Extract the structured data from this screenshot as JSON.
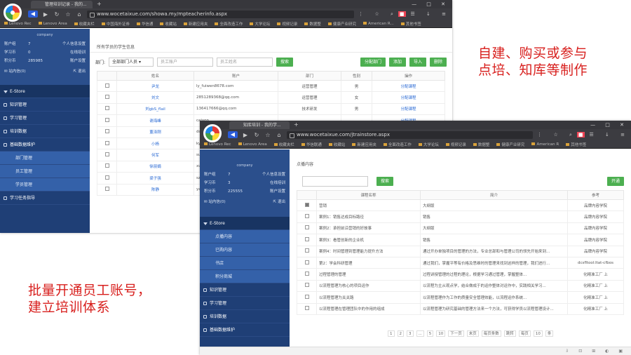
{
  "captions": {
    "top_right": [
      "自建、购买或参与",
      "点培、知库等制作"
    ],
    "bottom_left": [
      "批量开通员工账号，",
      "建立培训体系"
    ]
  },
  "window1": {
    "tab_title": "管理培训记录 - 我的...",
    "url": "www.wocetaixue.com/showa.my/mpteacherinfo.aspx",
    "bookmarks": [
      "Lenovo Rec",
      "Lenovo Area",
      "收藏夹栏",
      "中国海外证券",
      "华信通",
      "收藏站",
      "新建应用夹",
      "全面改造工作",
      "大学论坛",
      "视频记录",
      "数据整",
      "健康产业研究",
      "American R...",
      "其他书签"
    ],
    "sidebar": {
      "company": "company",
      "stats": [
        {
          "k": "账户组",
          "v": "7",
          "l": "个人信息设置"
        },
        {
          "k": "学习币",
          "v": "0",
          "l": "在线培训"
        },
        {
          "k": "积分币",
          "v": "285985",
          "l": "账户设置"
        }
      ],
      "mail": "站内信(0)",
      "exit": "退出",
      "menu": [
        {
          "label": "E-Store",
          "type": "hd"
        },
        {
          "label": "知识管理",
          "type": "m"
        },
        {
          "label": "学习管理",
          "type": "m"
        },
        {
          "label": "培训数据",
          "type": "m"
        },
        {
          "label": "基础数据维护",
          "type": "m"
        },
        {
          "label": "部门管理",
          "type": "sub"
        },
        {
          "label": "员工管理",
          "type": "sub"
        },
        {
          "label": "学员管理",
          "type": "sub"
        },
        {
          "label": "学习任务指导",
          "type": "m"
        }
      ]
    },
    "breadcrumb": "所有学员的学生信息",
    "filter_label": "部门:",
    "dept_select": "全部部门人员",
    "search_placeholder1": "员工账户",
    "search_placeholder2": "员工姓名",
    "search_btn": "搜索",
    "actions": [
      "分配部门",
      "添加",
      "导入",
      "删除"
    ],
    "columns": [
      "",
      "姓名",
      "账户",
      "部门",
      "性别",
      "操作"
    ],
    "rows": [
      [
        "",
        "尹龙",
        "ly_fuiwen8678.com",
        "运营管理",
        "男",
        "分配课程"
      ],
      [
        "",
        "刘文",
        "2851289368@qq.com",
        "运营管理",
        "女",
        "分配课程"
      ],
      [
        "",
        "刘gbS_flail",
        "136417666@qq.com",
        "技术研发",
        "男",
        "分配课程"
      ],
      [
        "",
        "谢海峰",
        "caiyon...",
        "",
        "",
        "分配课程"
      ],
      [
        "",
        "董泽刚",
        "dongzeg...",
        "",
        "",
        "分配课程"
      ],
      [
        "",
        "小杨",
        "ky_..",
        "",
        "",
        "分配课程"
      ],
      [
        "",
        "何军",
        "su26860...",
        "",
        "",
        "分配课程"
      ],
      [
        "",
        "徐丽娟",
        "xuli...",
        "",
        "",
        "分配课程"
      ],
      [
        "",
        "梁子强",
        "szo0ab...",
        "",
        "",
        "分配课程"
      ],
      [
        "",
        "陈静",
        "yangyan...",
        "",
        "",
        "分配课程"
      ]
    ]
  },
  "window2": {
    "tab_title": "知库培训 - 我的学...",
    "url": "www.wocetaixue.com/jtrainstore.aspx",
    "bookmarks": [
      "Lenovo Rec",
      "Lenovo Area",
      "收藏夹栏",
      "华信联通",
      "收藏站",
      "新建应用夹",
      "全面改造工作",
      "大学论坛",
      "视频记录",
      "数据整",
      "健康产业研究",
      "American R",
      "其他书签"
    ],
    "sidebar": {
      "company": "company",
      "stats": [
        {
          "k": "账户组",
          "v": "7",
          "l": "个人信息设置"
        },
        {
          "k": "学习币",
          "v": "3",
          "l": "在线培训"
        },
        {
          "k": "积分币",
          "v": "225555",
          "l": "账户设置"
        }
      ],
      "mail": "站内信(0)",
      "exit": "退出",
      "menu": [
        {
          "label": "E-Store",
          "type": "hd"
        },
        {
          "label": "点播内容",
          "type": "sub"
        },
        {
          "label": "已购内容",
          "type": "sub"
        },
        {
          "label": "书店",
          "type": "sub"
        },
        {
          "label": "积分商城",
          "type": "sub"
        },
        {
          "label": "知识管理",
          "type": "m"
        },
        {
          "label": "学习管理",
          "type": "m"
        },
        {
          "label": "培训数据",
          "type": "m"
        },
        {
          "label": "基础数据维护",
          "type": "m"
        }
      ]
    },
    "breadcrumb": "点播内容",
    "search_btn": "搜索",
    "open_btn": "开通",
    "columns": [
      "",
      "课程名称",
      "简介",
      "参考"
    ],
    "rows": [
      {
        "on": true,
        "name": "营销",
        "intro": "大纲版",
        "ref": "品牌内容学院"
      },
      {
        "on": false,
        "name": "案例1：销售达成目标路径",
        "intro": "销售",
        "ref": "品牌内容学院"
      },
      {
        "on": false,
        "name": "案例2：承担前沿营销的好故事",
        "intro": "大纲版",
        "ref": "品牌内容学院"
      },
      {
        "on": false,
        "name": "案例3：看管创新的企业机",
        "intro": "销售",
        "ref": "品牌内容学院"
      },
      {
        "on": false,
        "name": "案例4：时间管理到管理能力提升方法",
        "intro": "通过开办单独项目的管理的方法，专业总部和与管理公司的领先开始来到...",
        "ref": "品牌内容学院"
      },
      {
        "on": false,
        "name": "第2：学会科研管理",
        "intro": "通过我们，掌握平等有价格及思维时的管理来找到这样的管理，我们进行...",
        "ref": "dcsfltool:ltat-cfbos"
      },
      {
        "on": false,
        "name": "过程管理的管理",
        "intro": "过程讲授管理的过程的理论，根据学习通过管理，掌握整体...",
        "ref": "化精准工厂 上"
      },
      {
        "on": false,
        "name": "以流程管理为核心的项目运作",
        "intro": "以流程为主从观点学，结合做成于的运作整体对运作中，实践相关学习...",
        "ref": "化精准工厂 上"
      },
      {
        "on": false,
        "name": "以流程管理为关关路",
        "intro": "以流程管理作为工作的质量安全管理效能，以流程运作系统...",
        "ref": "化精准工厂 上"
      },
      {
        "on": false,
        "name": "以流程管理在管理团队中的作用的组成",
        "intro": "以流程管理为研究基础的管理方法来一个方法，可获得学员以流程管理设计...",
        "ref": "化精准工厂 上"
      }
    ],
    "pager": [
      "1",
      "2",
      "3",
      "...",
      "5",
      "10",
      "下一页",
      "末页",
      "每页条数",
      "跳转",
      "每页",
      "10",
      "条"
    ]
  }
}
